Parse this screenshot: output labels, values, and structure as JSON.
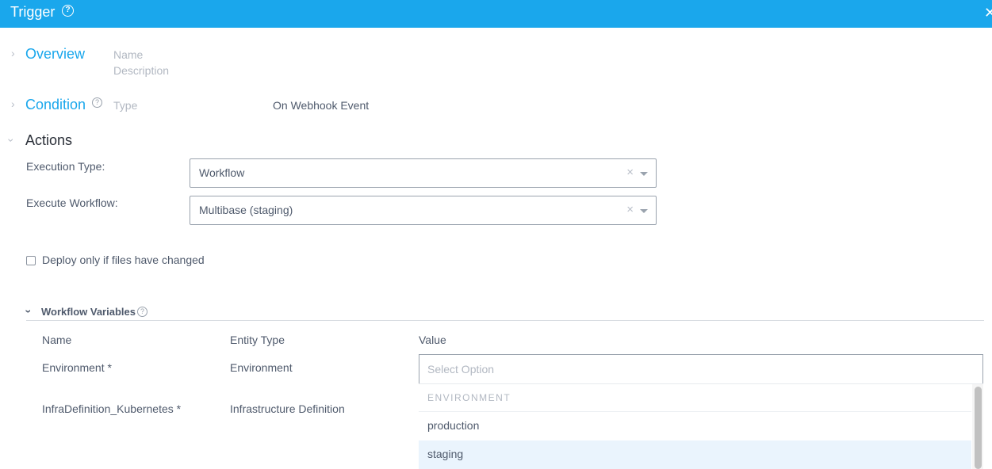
{
  "header": {
    "title": "Trigger",
    "help_icon": "question-circle-icon",
    "close_icon": "close-icon"
  },
  "sections": {
    "overview": {
      "title": "Overview",
      "fields": [
        "Name",
        "Description"
      ]
    },
    "condition": {
      "title": "Condition",
      "type_label": "Type",
      "type_value": "On Webhook Event"
    },
    "actions": {
      "title": "Actions"
    }
  },
  "actions_form": {
    "execution_type": {
      "label": "Execution Type:",
      "value": "Workflow"
    },
    "execute_workflow": {
      "label": "Execute Workflow:",
      "value": "Multibase (staging)"
    },
    "deploy_checkbox": {
      "label": "Deploy only if files have changed",
      "checked": false
    }
  },
  "workflow_variables": {
    "title": "Workflow Variables",
    "columns": [
      "Name",
      "Entity Type",
      "Value"
    ],
    "rows": [
      {
        "name": "Environment *",
        "entity_type": "Environment"
      },
      {
        "name": "InfraDefinition_Kubernetes *",
        "entity_type": "Infrastructure Definition"
      }
    ],
    "value_input": {
      "placeholder": "Select Option"
    },
    "dropdown": {
      "group": "ENVIRONMENT",
      "options": [
        "production",
        "staging"
      ],
      "highlighted": "staging"
    }
  }
}
